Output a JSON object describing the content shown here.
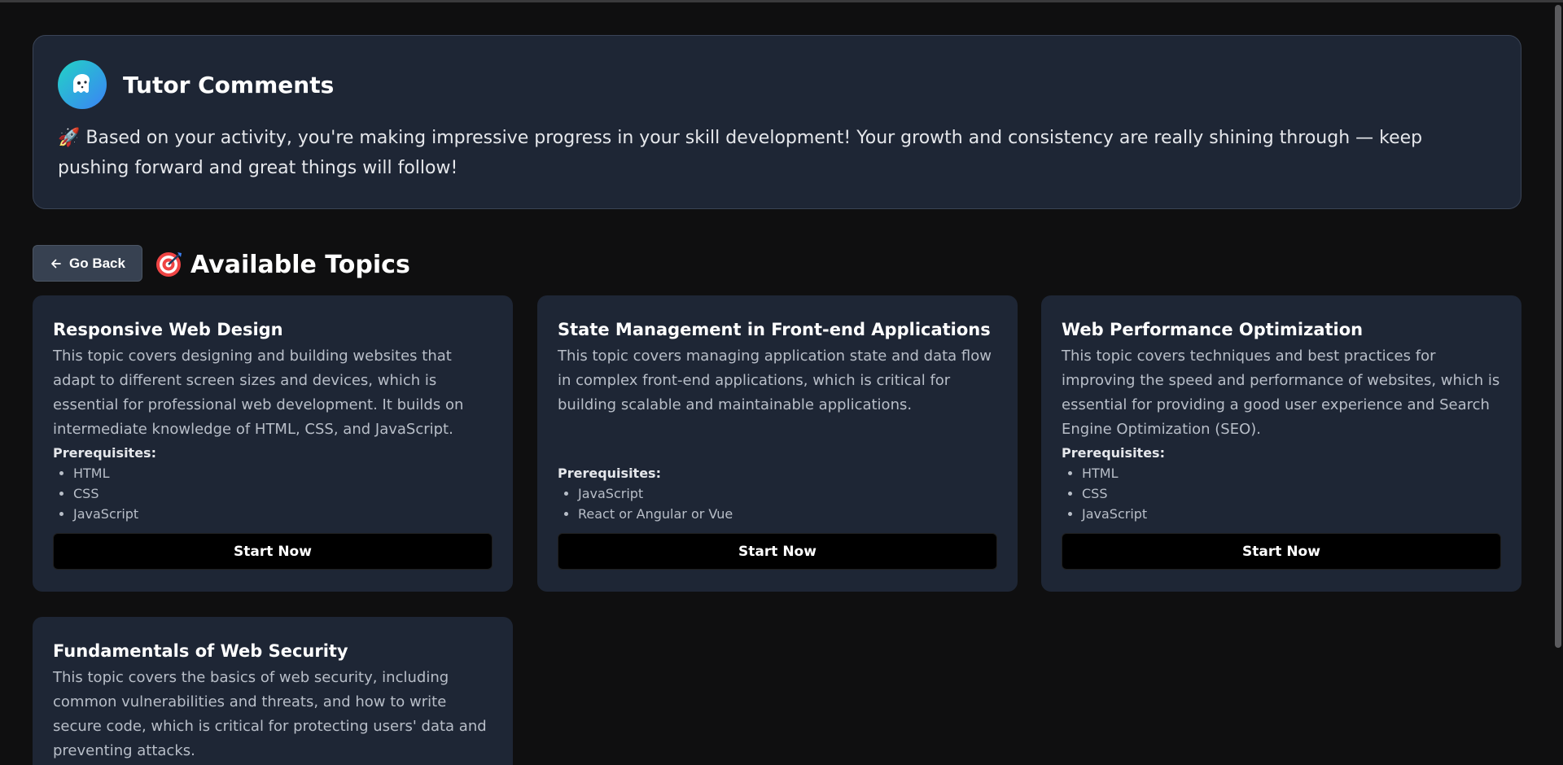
{
  "tutor": {
    "title": "Tutor Comments",
    "avatar_icon": "ghost-face-icon",
    "message": "🚀 Based on your activity, you're making impressive progress in your skill development! Your growth and consistency are really shining through — keep pushing forward and great things will follow!"
  },
  "toolbar": {
    "back_label": "Go Back",
    "back_icon": "arrow-left-icon",
    "heading_icon": "target-emoji",
    "heading": "Available Topics"
  },
  "prereq_label": "Prerequisites:",
  "start_label": "Start Now",
  "topics": [
    {
      "title": "Responsive Web Design",
      "description": "This topic covers designing and building websites that adapt to different screen sizes and devices, which is essential for professional web development. It builds on intermediate knowledge of HTML, CSS, and JavaScript.",
      "prerequisites": [
        "HTML",
        "CSS",
        "JavaScript"
      ]
    },
    {
      "title": "State Management in Front-end Applications",
      "description": "This topic covers managing application state and data flow in complex front-end applications, which is critical for building scalable and maintainable applications.",
      "prerequisites": [
        "JavaScript",
        "React or Angular or Vue"
      ]
    },
    {
      "title": "Web Performance Optimization",
      "description": "This topic covers techniques and best practices for improving the speed and performance of websites, which is essential for providing a good user experience and Search Engine Optimization (SEO).",
      "prerequisites": [
        "HTML",
        "CSS",
        "JavaScript"
      ]
    },
    {
      "title": "Fundamentals of Web Security",
      "description": "This topic covers the basics of web security, including common vulnerabilities and threats, and how to write secure code, which is critical for protecting users' data and preventing attacks."
    }
  ],
  "colors": {
    "background": "#0f0f10",
    "card": "#1e2635",
    "avatar_gradient_start": "#22d3c5",
    "avatar_gradient_end": "#3b82f6"
  }
}
